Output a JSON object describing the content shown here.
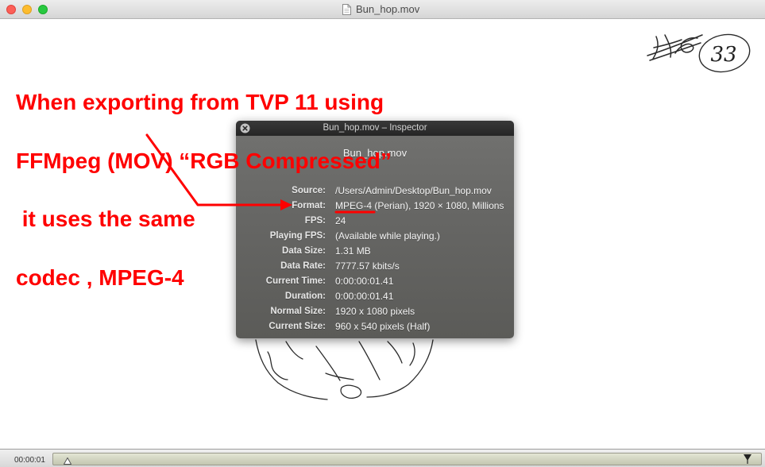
{
  "window": {
    "title": "Bun_hop.mov",
    "title_icon": "document-icon",
    "traffic_lights": {
      "close_color": "#fc5f57",
      "minimize_color": "#fdbc2e",
      "zoom_color": "#28c840"
    }
  },
  "annotation": {
    "color": "#ff0000",
    "lines": [
      "When exporting from TVP 11 using",
      "FFMpeg (MOV) “RGB Compressed”",
      " it uses the same",
      "codec , MPEG-4"
    ]
  },
  "inspector": {
    "title": "Bun_hop.mov – Inspector",
    "close_icon": "close-icon",
    "file_name": "Bun_hop.mov",
    "rows": [
      {
        "label": "Source:",
        "value": "/Users/Admin/Desktop/Bun_hop.mov"
      },
      {
        "label": "Format:",
        "value": "MPEG-4 (Perian), 1920 × 1080, Millions"
      },
      {
        "label": "FPS:",
        "value": "24"
      },
      {
        "label": "Playing FPS:",
        "value": "(Available while playing.)"
      },
      {
        "label": "Data Size:",
        "value": "1.31 MB"
      },
      {
        "label": "Data Rate:",
        "value": "7777.57 kbits/s"
      },
      {
        "label": "Current Time:",
        "value": "0:00:00:01.41"
      },
      {
        "label": "Duration:",
        "value": "0:00:00:01.41"
      },
      {
        "label": "Normal Size:",
        "value": "1920 x 1080 pixels"
      },
      {
        "label": "Current Size:",
        "value": "960 x 540 pixels (Half)"
      }
    ]
  },
  "video": {
    "frame_number_sketch": "33"
  },
  "controls": {
    "timecode": "00:00:01",
    "playhead_fraction": 0.02,
    "playhead_icon": "playhead-icon",
    "out_marker_icon": "out-point-marker-icon"
  }
}
